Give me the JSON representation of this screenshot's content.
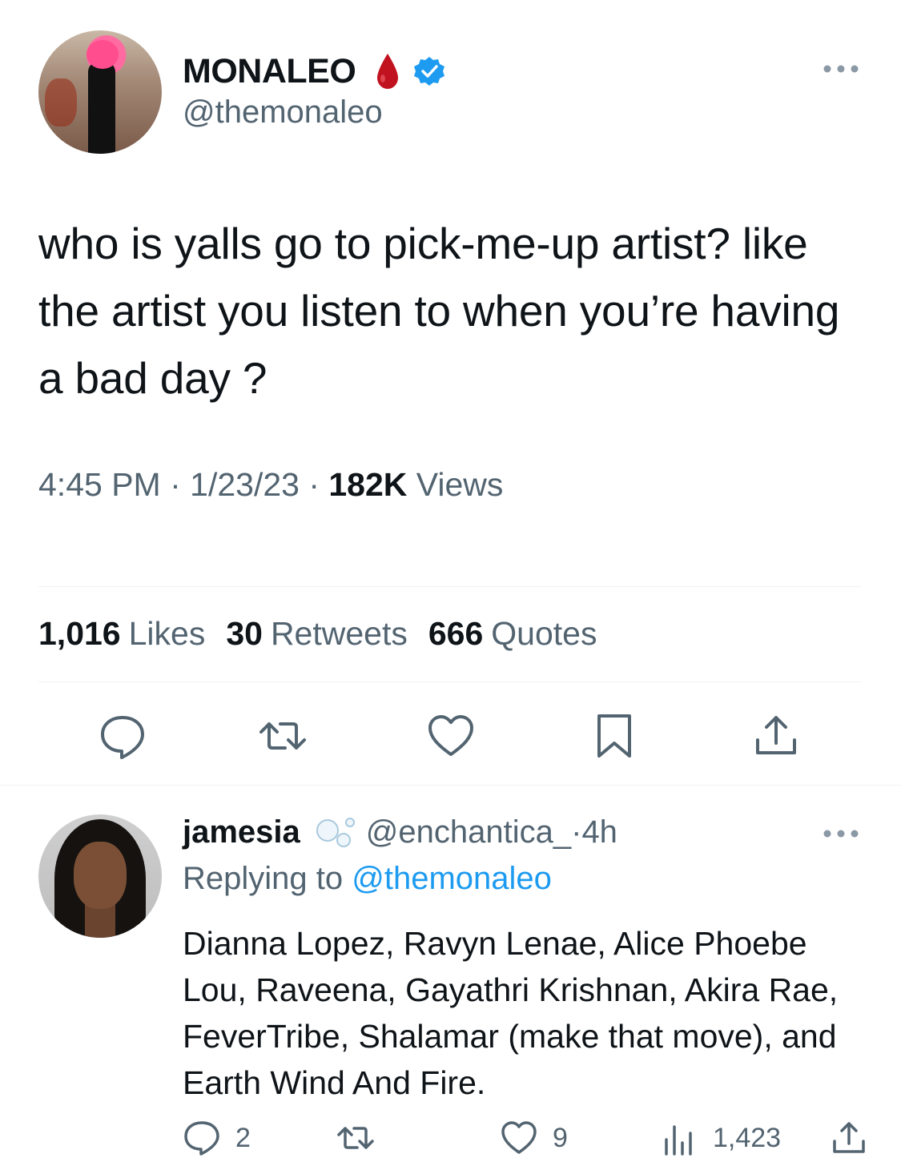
{
  "main_tweet": {
    "author_name": "MONALEO",
    "author_handle": "@themonaleo",
    "text": "who is yalls go to pick-me-up artist? like the artist you listen to when you’re having a bad day ?",
    "time": "4:45 PM",
    "separator": " · ",
    "date": "1/23/23",
    "views_count": "182K",
    "views_label": " Views",
    "stats": {
      "likes_count": "1,016",
      "likes_label": "Likes",
      "retweets_count": "30",
      "retweets_label": "Retweets",
      "quotes_count": "666",
      "quotes_label": "Quotes"
    },
    "icons": [
      "reply-icon",
      "retweet-icon",
      "like-icon",
      "bookmark-icon",
      "share-icon"
    ]
  },
  "reply": {
    "author_name": "jamesia",
    "author_handle": "@enchantica_",
    "separator": " · ",
    "age": "4h",
    "replying_prefix": "Replying to ",
    "replying_to": "@themonaleo",
    "text": "Dianna Lopez, Ravyn Lenae, Alice Phoebe Lou, Raveena, Gayathri Krishnan, Akira Rae, FeverTribe, Shalamar (make that move), and Earth Wind And Fire.",
    "reply_count": "2",
    "like_count": "9",
    "view_count": "1,423"
  },
  "colors": {
    "text_primary": "#0f1419",
    "text_secondary": "#536471",
    "link": "#1d9bf0",
    "verified": "#1d9bf0",
    "drop": "#c1121f",
    "divider": "#eff3f4"
  }
}
